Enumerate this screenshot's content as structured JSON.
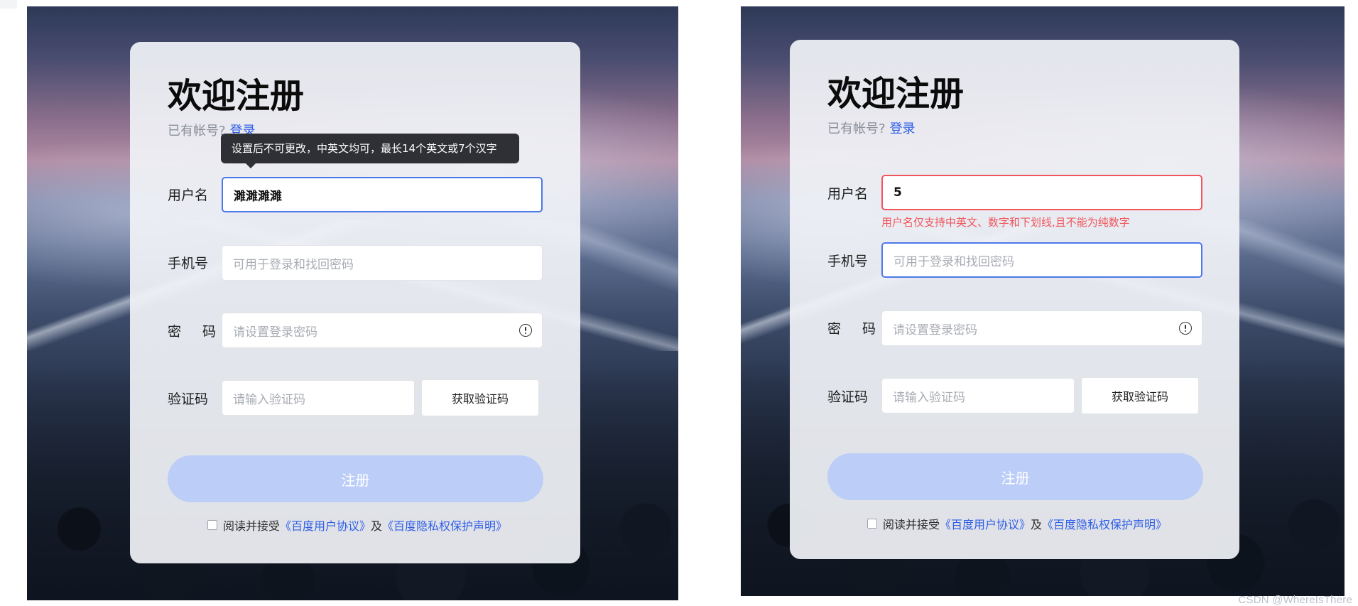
{
  "watermark": "CSDN @WhereIsThere",
  "colors": {
    "accent": "#2f5fe8",
    "focus_border": "#4d78e8",
    "error": "#f0565c",
    "submit_disabled": "#bccdf8",
    "tooltip_bg": "#2e3035"
  },
  "panels": [
    {
      "state": "tooltip",
      "title": "欢迎注册",
      "have_account": "已有帐号?",
      "login_link": "登录",
      "tooltip": "设置后不可更改，中英文均可，最长14个英文或7个汉字",
      "username": {
        "label": "用户名",
        "value": "濉濉濉濉",
        "placeholder": ""
      },
      "phone": {
        "label": "手机号",
        "placeholder": "可用于登录和找回密码"
      },
      "password": {
        "label": "密 码",
        "placeholder": "请设置登录密码",
        "icon": "info-circle-icon"
      },
      "code": {
        "label": "验证码",
        "placeholder": "请输入验证码",
        "button": "获取验证码"
      },
      "submit": "注册",
      "agree_prefix": "阅读并接受",
      "agree_link1": "《百度用户协议》",
      "agree_mid": "及",
      "agree_link2": "《百度隐私权保护声明》"
    },
    {
      "state": "error",
      "title": "欢迎注册",
      "have_account": "已有帐号?",
      "login_link": "登录",
      "error": "用户名仅支持中英文、数字和下划线,且不能为纯数字",
      "username": {
        "label": "用户名",
        "value": "5",
        "placeholder": ""
      },
      "phone": {
        "label": "手机号",
        "placeholder": "可用于登录和找回密码"
      },
      "password": {
        "label": "密 码",
        "placeholder": "请设置登录密码",
        "icon": "info-circle-icon"
      },
      "code": {
        "label": "验证码",
        "placeholder": "请输入验证码",
        "button": "获取验证码"
      },
      "submit": "注册",
      "agree_prefix": "阅读并接受",
      "agree_link1": "《百度用户协议》",
      "agree_mid": "及",
      "agree_link2": "《百度隐私权保护声明》"
    }
  ]
}
